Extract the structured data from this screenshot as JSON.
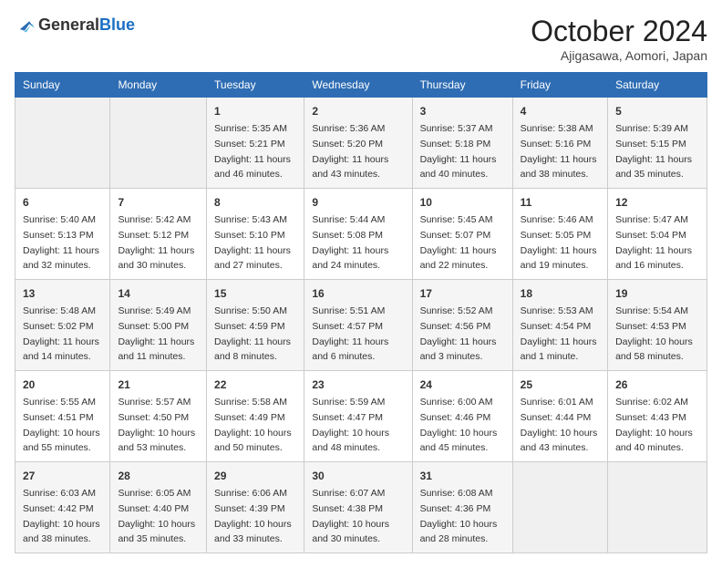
{
  "logo": {
    "general": "General",
    "blue": "Blue"
  },
  "title": "October 2024",
  "subtitle": "Ajigasawa, Aomori, Japan",
  "headers": [
    "Sunday",
    "Monday",
    "Tuesday",
    "Wednesday",
    "Thursday",
    "Friday",
    "Saturday"
  ],
  "weeks": [
    [
      {
        "day": null,
        "sunrise": null,
        "sunset": null,
        "daylight": null
      },
      {
        "day": null,
        "sunrise": null,
        "sunset": null,
        "daylight": null
      },
      {
        "day": "1",
        "sunrise": "Sunrise: 5:35 AM",
        "sunset": "Sunset: 5:21 PM",
        "daylight": "Daylight: 11 hours and 46 minutes."
      },
      {
        "day": "2",
        "sunrise": "Sunrise: 5:36 AM",
        "sunset": "Sunset: 5:20 PM",
        "daylight": "Daylight: 11 hours and 43 minutes."
      },
      {
        "day": "3",
        "sunrise": "Sunrise: 5:37 AM",
        "sunset": "Sunset: 5:18 PM",
        "daylight": "Daylight: 11 hours and 40 minutes."
      },
      {
        "day": "4",
        "sunrise": "Sunrise: 5:38 AM",
        "sunset": "Sunset: 5:16 PM",
        "daylight": "Daylight: 11 hours and 38 minutes."
      },
      {
        "day": "5",
        "sunrise": "Sunrise: 5:39 AM",
        "sunset": "Sunset: 5:15 PM",
        "daylight": "Daylight: 11 hours and 35 minutes."
      }
    ],
    [
      {
        "day": "6",
        "sunrise": "Sunrise: 5:40 AM",
        "sunset": "Sunset: 5:13 PM",
        "daylight": "Daylight: 11 hours and 32 minutes."
      },
      {
        "day": "7",
        "sunrise": "Sunrise: 5:42 AM",
        "sunset": "Sunset: 5:12 PM",
        "daylight": "Daylight: 11 hours and 30 minutes."
      },
      {
        "day": "8",
        "sunrise": "Sunrise: 5:43 AM",
        "sunset": "Sunset: 5:10 PM",
        "daylight": "Daylight: 11 hours and 27 minutes."
      },
      {
        "day": "9",
        "sunrise": "Sunrise: 5:44 AM",
        "sunset": "Sunset: 5:08 PM",
        "daylight": "Daylight: 11 hours and 24 minutes."
      },
      {
        "day": "10",
        "sunrise": "Sunrise: 5:45 AM",
        "sunset": "Sunset: 5:07 PM",
        "daylight": "Daylight: 11 hours and 22 minutes."
      },
      {
        "day": "11",
        "sunrise": "Sunrise: 5:46 AM",
        "sunset": "Sunset: 5:05 PM",
        "daylight": "Daylight: 11 hours and 19 minutes."
      },
      {
        "day": "12",
        "sunrise": "Sunrise: 5:47 AM",
        "sunset": "Sunset: 5:04 PM",
        "daylight": "Daylight: 11 hours and 16 minutes."
      }
    ],
    [
      {
        "day": "13",
        "sunrise": "Sunrise: 5:48 AM",
        "sunset": "Sunset: 5:02 PM",
        "daylight": "Daylight: 11 hours and 14 minutes."
      },
      {
        "day": "14",
        "sunrise": "Sunrise: 5:49 AM",
        "sunset": "Sunset: 5:00 PM",
        "daylight": "Daylight: 11 hours and 11 minutes."
      },
      {
        "day": "15",
        "sunrise": "Sunrise: 5:50 AM",
        "sunset": "Sunset: 4:59 PM",
        "daylight": "Daylight: 11 hours and 8 minutes."
      },
      {
        "day": "16",
        "sunrise": "Sunrise: 5:51 AM",
        "sunset": "Sunset: 4:57 PM",
        "daylight": "Daylight: 11 hours and 6 minutes."
      },
      {
        "day": "17",
        "sunrise": "Sunrise: 5:52 AM",
        "sunset": "Sunset: 4:56 PM",
        "daylight": "Daylight: 11 hours and 3 minutes."
      },
      {
        "day": "18",
        "sunrise": "Sunrise: 5:53 AM",
        "sunset": "Sunset: 4:54 PM",
        "daylight": "Daylight: 11 hours and 1 minute."
      },
      {
        "day": "19",
        "sunrise": "Sunrise: 5:54 AM",
        "sunset": "Sunset: 4:53 PM",
        "daylight": "Daylight: 10 hours and 58 minutes."
      }
    ],
    [
      {
        "day": "20",
        "sunrise": "Sunrise: 5:55 AM",
        "sunset": "Sunset: 4:51 PM",
        "daylight": "Daylight: 10 hours and 55 minutes."
      },
      {
        "day": "21",
        "sunrise": "Sunrise: 5:57 AM",
        "sunset": "Sunset: 4:50 PM",
        "daylight": "Daylight: 10 hours and 53 minutes."
      },
      {
        "day": "22",
        "sunrise": "Sunrise: 5:58 AM",
        "sunset": "Sunset: 4:49 PM",
        "daylight": "Daylight: 10 hours and 50 minutes."
      },
      {
        "day": "23",
        "sunrise": "Sunrise: 5:59 AM",
        "sunset": "Sunset: 4:47 PM",
        "daylight": "Daylight: 10 hours and 48 minutes."
      },
      {
        "day": "24",
        "sunrise": "Sunrise: 6:00 AM",
        "sunset": "Sunset: 4:46 PM",
        "daylight": "Daylight: 10 hours and 45 minutes."
      },
      {
        "day": "25",
        "sunrise": "Sunrise: 6:01 AM",
        "sunset": "Sunset: 4:44 PM",
        "daylight": "Daylight: 10 hours and 43 minutes."
      },
      {
        "day": "26",
        "sunrise": "Sunrise: 6:02 AM",
        "sunset": "Sunset: 4:43 PM",
        "daylight": "Daylight: 10 hours and 40 minutes."
      }
    ],
    [
      {
        "day": "27",
        "sunrise": "Sunrise: 6:03 AM",
        "sunset": "Sunset: 4:42 PM",
        "daylight": "Daylight: 10 hours and 38 minutes."
      },
      {
        "day": "28",
        "sunrise": "Sunrise: 6:05 AM",
        "sunset": "Sunset: 4:40 PM",
        "daylight": "Daylight: 10 hours and 35 minutes."
      },
      {
        "day": "29",
        "sunrise": "Sunrise: 6:06 AM",
        "sunset": "Sunset: 4:39 PM",
        "daylight": "Daylight: 10 hours and 33 minutes."
      },
      {
        "day": "30",
        "sunrise": "Sunrise: 6:07 AM",
        "sunset": "Sunset: 4:38 PM",
        "daylight": "Daylight: 10 hours and 30 minutes."
      },
      {
        "day": "31",
        "sunrise": "Sunrise: 6:08 AM",
        "sunset": "Sunset: 4:36 PM",
        "daylight": "Daylight: 10 hours and 28 minutes."
      },
      {
        "day": null,
        "sunrise": null,
        "sunset": null,
        "daylight": null
      },
      {
        "day": null,
        "sunrise": null,
        "sunset": null,
        "daylight": null
      }
    ]
  ]
}
